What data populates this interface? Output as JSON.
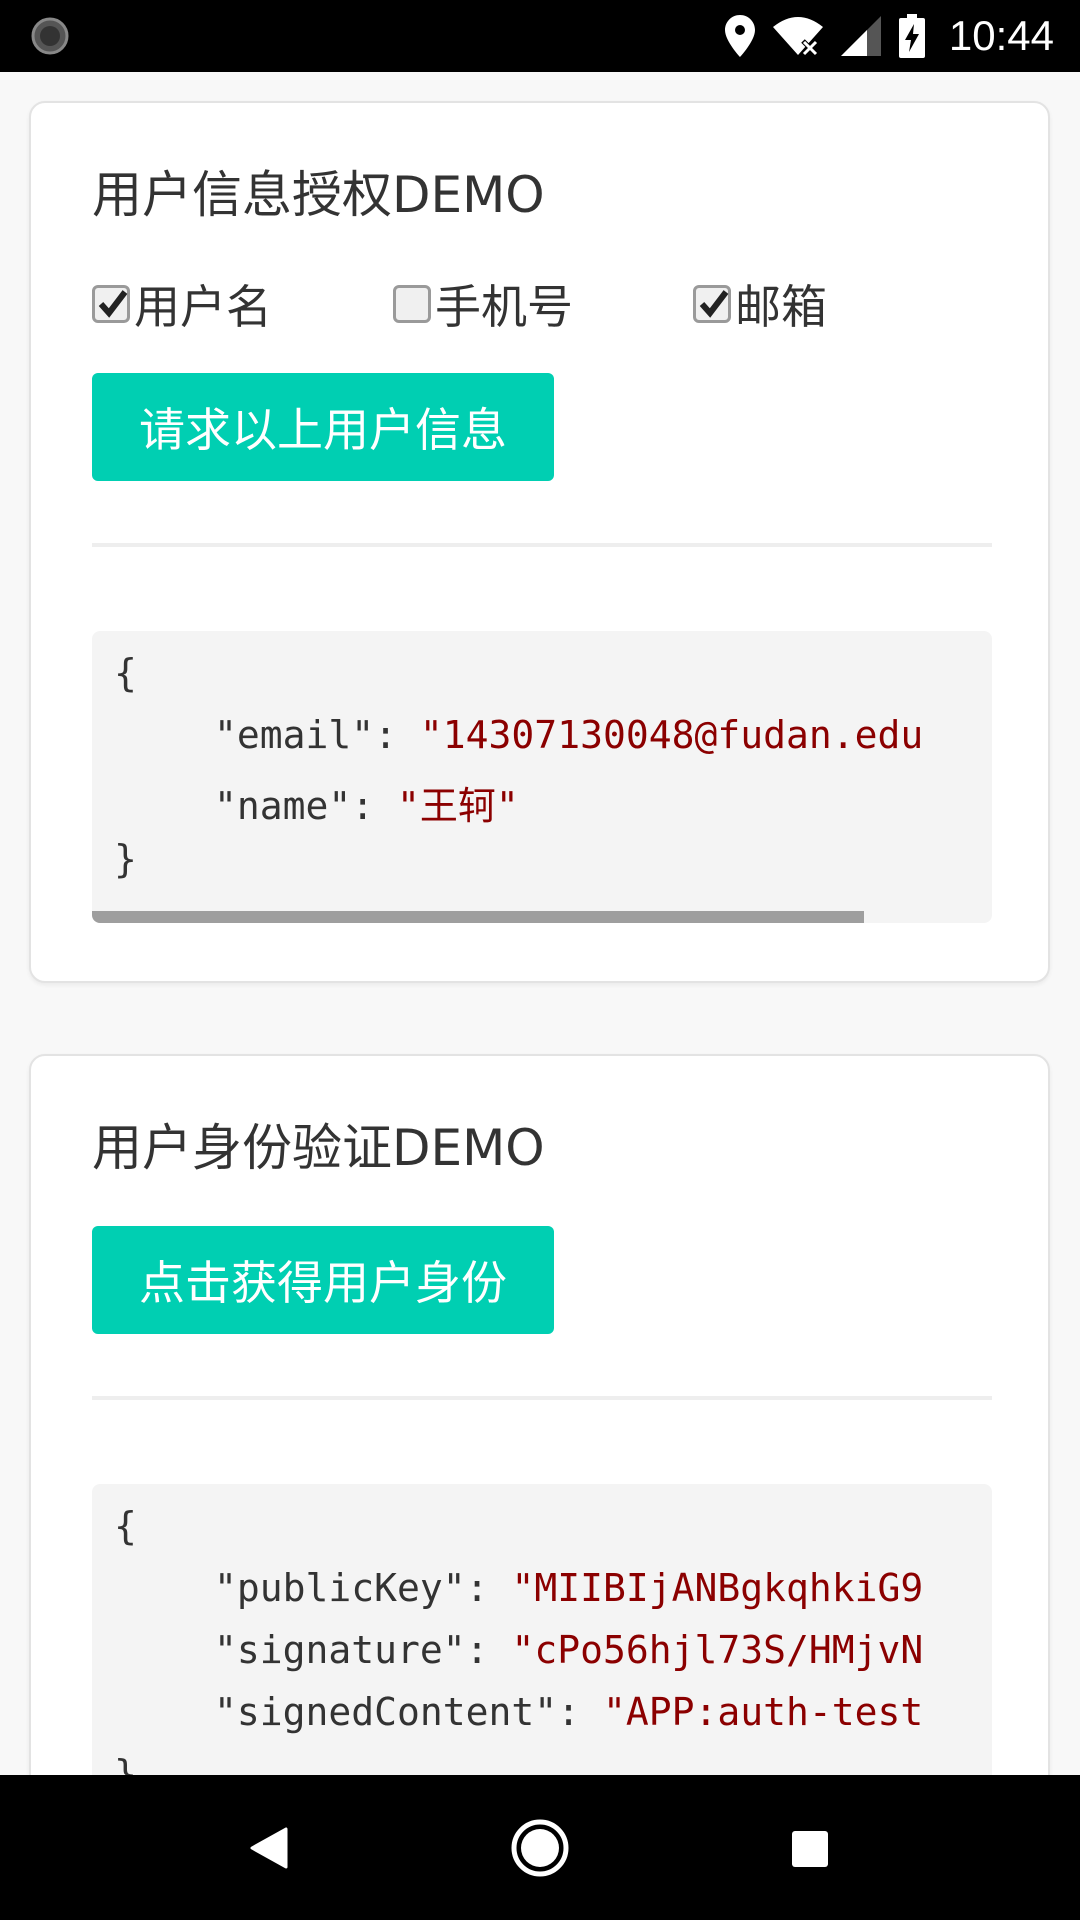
{
  "status_bar": {
    "time": "10:44",
    "icons": [
      "loading-circle-icon",
      "location-icon",
      "wifi-off-icon",
      "cell-signal-icon",
      "battery-charging-icon"
    ]
  },
  "auth_card": {
    "title": "用户信息授权DEMO",
    "checkboxes": [
      {
        "label": "用户名",
        "checked": true
      },
      {
        "label": "手机号",
        "checked": false
      },
      {
        "label": "邮箱",
        "checked": true
      }
    ],
    "button_label": "请求以上用户信息",
    "code": {
      "open": "{",
      "lines": [
        {
          "key": "\"email\"",
          "sep": ": ",
          "value": "\"14307130048@fudan.edu"
        },
        {
          "key": "\"name\"",
          "sep": ": ",
          "value": "\"王轲\""
        }
      ],
      "close": "}"
    }
  },
  "identity_card": {
    "title": "用户身份验证DEMO",
    "button_label": "点击获得用户身份",
    "code": {
      "open": "{",
      "lines": [
        {
          "key": "\"publicKey\"",
          "sep": ": ",
          "value": "\"MIIBIjANBgkqhkiG9"
        },
        {
          "key": "\"signature\"",
          "sep": ": ",
          "value": "\"cPo56hjl73S/HMjvN"
        },
        {
          "key": "\"signedContent\"",
          "sep": ": ",
          "value": "\"APP:auth-test"
        }
      ],
      "close": "}"
    }
  },
  "colors": {
    "accent": "#00cfb2",
    "string_value": "#8b0000",
    "text": "#333333"
  },
  "nav_bar": {
    "icons": [
      "back-icon",
      "home-icon",
      "recents-icon"
    ]
  }
}
